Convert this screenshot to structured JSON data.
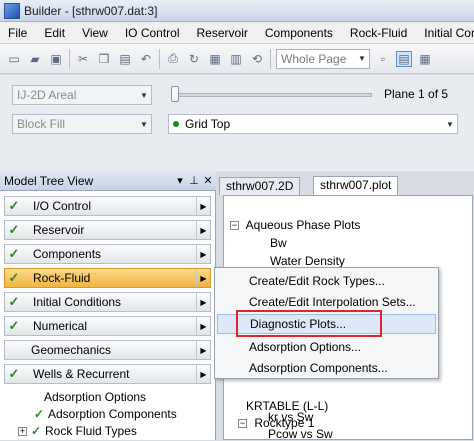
{
  "window": {
    "title": "Builder - [sthrw007.dat:3]"
  },
  "menubar": [
    "File",
    "Edit",
    "View",
    "IO Control",
    "Reservoir",
    "Components",
    "Rock-Fluid",
    "Initial Conditi"
  ],
  "toolbar": {
    "zoom_value": "Whole Page"
  },
  "controls": {
    "view_mode": "IJ-2D Areal",
    "fill_mode": "Block Fill",
    "plane_label": "Plane 1 of 5",
    "layer_value": "Grid Top"
  },
  "model_tree": {
    "title": "Model Tree View",
    "header_icons": [
      "pin-icon",
      "close-icon"
    ],
    "modules": [
      {
        "label": "I/O Control",
        "checked": true
      },
      {
        "label": "Reservoir",
        "checked": true
      },
      {
        "label": "Components",
        "checked": true
      },
      {
        "label": "Rock-Fluid",
        "checked": true,
        "active": true
      },
      {
        "label": "Initial Conditions",
        "checked": true
      },
      {
        "label": "Numerical",
        "checked": true
      },
      {
        "label": "Geomechanics",
        "checked": false
      },
      {
        "label": "Wells & Recurrent",
        "checked": true
      }
    ],
    "subtree": [
      "Adsorption Options",
      "Adsorption Components",
      "Rock Fluid Types"
    ]
  },
  "tabs": [
    "sthrw007.2D",
    "sthrw007.plot"
  ],
  "plot_tree": {
    "items": [
      "Aqueous Phase Plots",
      "Bw",
      "Water Density",
      "KRTABLE (L-L)",
      "Rocktype 1",
      "kr vs Sw",
      "Pcow vs Sw"
    ]
  },
  "context_menu": {
    "items": [
      "Create/Edit Rock Types...",
      "Create/Edit Interpolation Sets...",
      "Diagnostic Plots...",
      "Adsorption Options...",
      "Adsorption Components..."
    ],
    "highlighted": "Diagnostic Plots..."
  },
  "colors": {
    "accent": "#e0262b",
    "active_module": "#f2b43f",
    "check": "#2a8a2a"
  }
}
